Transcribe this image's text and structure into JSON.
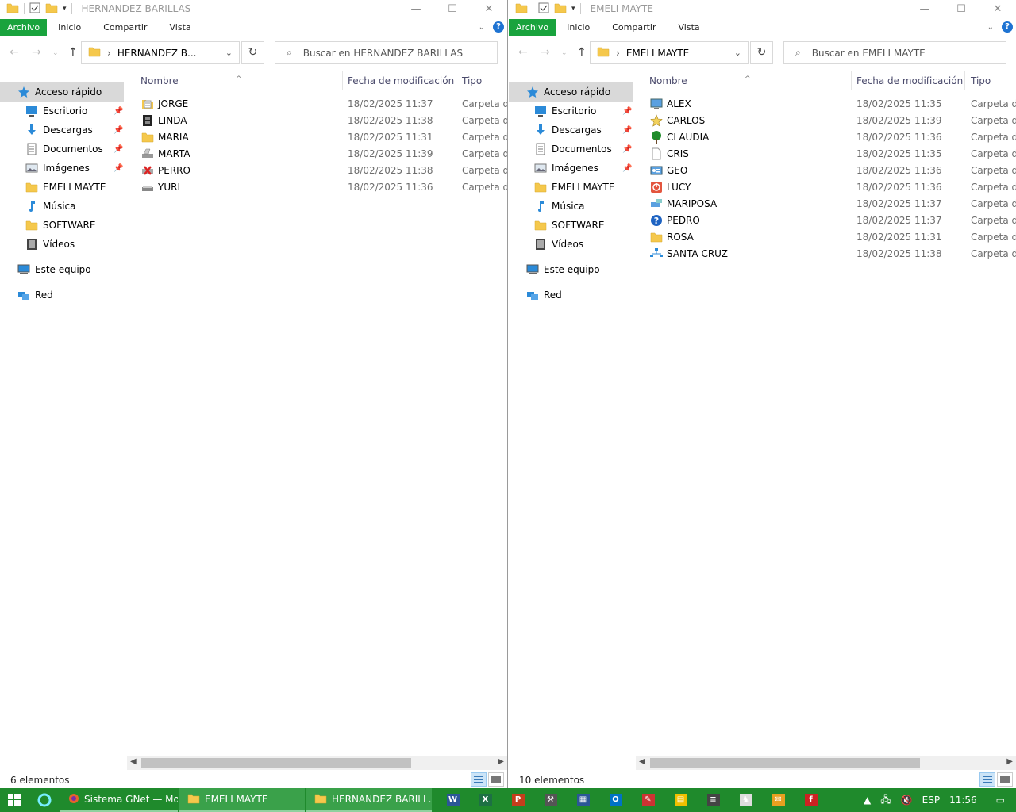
{
  "left": {
    "title": "HERNANDEZ BARILLAS",
    "ribbon_tabs": [
      "Archivo",
      "Inicio",
      "Compartir",
      "Vista"
    ],
    "address_path": "HERNANDEZ B...",
    "search_placeholder": "Buscar en HERNANDEZ BARILLAS",
    "nav": [
      {
        "label": "Acceso rápido",
        "icon": "star-icon",
        "pinned": false,
        "selected": true,
        "indent": 0
      },
      {
        "label": "Escritorio",
        "icon": "desktop-icon",
        "pinned": true,
        "indent": 1
      },
      {
        "label": "Descargas",
        "icon": "download-icon",
        "pinned": true,
        "indent": 1
      },
      {
        "label": "Documentos",
        "icon": "document-icon",
        "pinned": true,
        "indent": 1
      },
      {
        "label": "Imágenes",
        "icon": "image-icon",
        "pinned": true,
        "indent": 1
      },
      {
        "label": "EMELI MAYTE",
        "icon": "folder-icon",
        "pinned": false,
        "indent": 1
      },
      {
        "label": "Música",
        "icon": "music-icon",
        "pinned": false,
        "indent": 1
      },
      {
        "label": "SOFTWARE",
        "icon": "folder-icon",
        "pinned": false,
        "indent": 1
      },
      {
        "label": "Vídeos",
        "icon": "video-icon",
        "pinned": false,
        "indent": 1
      },
      {
        "label": "Este equipo",
        "icon": "computer-icon",
        "pinned": false,
        "indent": 0,
        "gap": true
      },
      {
        "label": "Red",
        "icon": "network-icon",
        "pinned": false,
        "indent": 0,
        "gap": true
      }
    ],
    "columns": {
      "name": "Nombre",
      "date": "Fecha de modificación",
      "type": "Tipo"
    },
    "files": [
      {
        "name": "JORGE",
        "date": "18/02/2025 11:37",
        "type": "Carpeta de",
        "icon": "notepad-folder-icon"
      },
      {
        "name": "LINDA",
        "date": "18/02/2025 11:38",
        "type": "Carpeta de",
        "icon": "film-icon"
      },
      {
        "name": "MARIA",
        "date": "18/02/2025 11:31",
        "type": "Carpeta de",
        "icon": "folder-icon"
      },
      {
        "name": "MARTA",
        "date": "18/02/2025 11:39",
        "type": "Carpeta de",
        "icon": "scanner-icon"
      },
      {
        "name": "PERRO",
        "date": "18/02/2025 11:38",
        "type": "Carpeta de",
        "icon": "printer-error-icon"
      },
      {
        "name": "YURI",
        "date": "18/02/2025 11:36",
        "type": "Carpeta de",
        "icon": "drive-icon"
      }
    ],
    "status": "6 elementos"
  },
  "right": {
    "title": "EMELI MAYTE",
    "ribbon_tabs": [
      "Archivo",
      "Inicio",
      "Compartir",
      "Vista"
    ],
    "address_path": "EMELI MAYTE",
    "search_placeholder": "Buscar en EMELI MAYTE",
    "nav": [
      {
        "label": "Acceso rápido",
        "icon": "star-icon",
        "pinned": false,
        "selected": true,
        "indent": 0
      },
      {
        "label": "Escritorio",
        "icon": "desktop-icon",
        "pinned": true,
        "indent": 1
      },
      {
        "label": "Descargas",
        "icon": "download-icon",
        "pinned": true,
        "indent": 1
      },
      {
        "label": "Documentos",
        "icon": "document-icon",
        "pinned": true,
        "indent": 1
      },
      {
        "label": "Imágenes",
        "icon": "image-icon",
        "pinned": true,
        "indent": 1
      },
      {
        "label": "EMELI MAYTE",
        "icon": "folder-icon",
        "pinned": false,
        "indent": 1
      },
      {
        "label": "Música",
        "icon": "music-icon",
        "pinned": false,
        "indent": 1
      },
      {
        "label": "SOFTWARE",
        "icon": "folder-icon",
        "pinned": false,
        "indent": 1
      },
      {
        "label": "Vídeos",
        "icon": "video-icon",
        "pinned": false,
        "indent": 1
      },
      {
        "label": "Este equipo",
        "icon": "computer-icon",
        "pinned": false,
        "indent": 0,
        "gap": true
      },
      {
        "label": "Red",
        "icon": "network-icon",
        "pinned": false,
        "indent": 0,
        "gap": true
      }
    ],
    "columns": {
      "name": "Nombre",
      "date": "Fecha de modificación",
      "type": "Tipo"
    },
    "files": [
      {
        "name": "ALEX",
        "date": "18/02/2025 11:35",
        "type": "Carpeta de",
        "icon": "monitor-icon"
      },
      {
        "name": "CARLOS",
        "date": "18/02/2025 11:39",
        "type": "Carpeta de",
        "icon": "star-badge-icon"
      },
      {
        "name": "CLAUDIA",
        "date": "18/02/2025 11:36",
        "type": "Carpeta de",
        "icon": "tree-icon"
      },
      {
        "name": "CRIS",
        "date": "18/02/2025 11:35",
        "type": "Carpeta de",
        "icon": "blank-file-icon"
      },
      {
        "name": "GEO",
        "date": "18/02/2025 11:36",
        "type": "Carpeta de",
        "icon": "id-card-icon"
      },
      {
        "name": "LUCY",
        "date": "18/02/2025 11:36",
        "type": "Carpeta de",
        "icon": "power-icon"
      },
      {
        "name": "MARIPOSA",
        "date": "18/02/2025 11:37",
        "type": "Carpeta de",
        "icon": "network-drive-icon"
      },
      {
        "name": "PEDRO",
        "date": "18/02/2025 11:37",
        "type": "Carpeta de",
        "icon": "help-icon"
      },
      {
        "name": "ROSA",
        "date": "18/02/2025 11:31",
        "type": "Carpeta de",
        "icon": "folder-icon"
      },
      {
        "name": "SANTA CRUZ",
        "date": "18/02/2025 11:38",
        "type": "Carpeta de",
        "icon": "network-tree-icon"
      }
    ],
    "status": "10 elementos"
  },
  "taskbar": {
    "apps": [
      {
        "label": "Sistema GNet — Mo...",
        "icon": "firefox-icon",
        "active": false
      },
      {
        "label": "EMELI MAYTE",
        "icon": "folder-icon",
        "active": true
      },
      {
        "label": "HERNANDEZ BARILL...",
        "icon": "folder-icon",
        "active": true
      }
    ],
    "pinned_icons": [
      "word-icon",
      "excel-icon",
      "powerpoint-icon",
      "tool-icon",
      "calendar-icon",
      "outlook-icon",
      "pen-icon",
      "notes-icon",
      "server-icon",
      "chess-icon",
      "mail-icon",
      "flash-icon"
    ],
    "lang": "ESP",
    "time": "11:56"
  },
  "colors": {
    "accent": "#19a33d",
    "taskbar": "#1f8a2c",
    "folder": "#f5c84c",
    "blue": "#1e73d2"
  }
}
